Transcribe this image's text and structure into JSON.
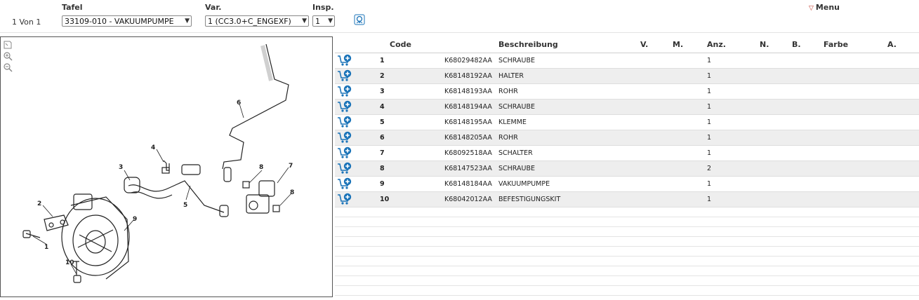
{
  "header": {
    "tafel_label": "Tafel",
    "var_label": "Var.",
    "insp_label": "Insp.",
    "pager": "1 Von 1",
    "tafel_value": "33109-010 - VAKUUMPUMPE",
    "var_value": "1 (CC3.0+C_ENGEXF)",
    "insp_value": "1",
    "lens_icon": "magnifier-icon",
    "menu_label": "Menu"
  },
  "diagram": {
    "tool_icons": [
      "fit-to-window-icon",
      "zoom-in-icon",
      "zoom-out-icon"
    ],
    "callouts": [
      "1",
      "2",
      "3",
      "4",
      "5",
      "6",
      "7",
      "8",
      "8",
      "9",
      "10"
    ]
  },
  "table": {
    "columns": {
      "code": "Code",
      "beschreibung": "Beschreibung",
      "v": "V.",
      "m": "M.",
      "anz": "Anz.",
      "n": "N.",
      "b": "B.",
      "farbe": "Farbe",
      "a": "A."
    },
    "cart_icon": "add-to-cart-icon",
    "rows": [
      {
        "pos": "1",
        "code": "K68029482AA",
        "desc": "SCHRAUBE",
        "anz": "1"
      },
      {
        "pos": "2",
        "code": "K68148192AA",
        "desc": "HALTER",
        "anz": "1"
      },
      {
        "pos": "3",
        "code": "K68148193AA",
        "desc": "ROHR",
        "anz": "1"
      },
      {
        "pos": "4",
        "code": "K68148194AA",
        "desc": "SCHRAUBE",
        "anz": "1"
      },
      {
        "pos": "5",
        "code": "K68148195AA",
        "desc": "KLEMME",
        "anz": "1"
      },
      {
        "pos": "6",
        "code": "K68148205AA",
        "desc": "ROHR",
        "anz": "1"
      },
      {
        "pos": "7",
        "code": "K68092518AA",
        "desc": "SCHALTER",
        "anz": "1"
      },
      {
        "pos": "8",
        "code": "K68147523AA",
        "desc": "SCHRAUBE",
        "anz": "2"
      },
      {
        "pos": "9",
        "code": "K68148184AA",
        "desc": "VAKUUMPUMPE",
        "anz": "1"
      },
      {
        "pos": "10",
        "code": "K68042012AA",
        "desc": "BEFESTIGUNGSKIT",
        "anz": "1"
      }
    ]
  },
  "colors": {
    "cart_blue": "#1a73b8",
    "row_alt": "#eeeeee",
    "menu_triangle": "#c0392b"
  }
}
